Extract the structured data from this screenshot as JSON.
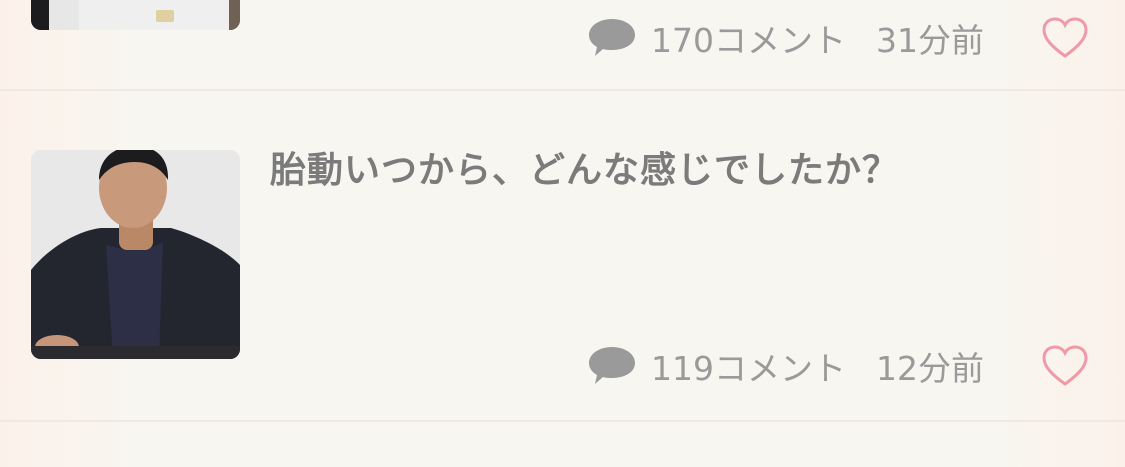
{
  "feed": {
    "items": [
      {
        "comments": "170コメント",
        "time": "31分前",
        "icons": {
          "comment": "speech-bubble-icon",
          "like": "heart-outline-icon"
        }
      },
      {
        "title": "胎動いつから、どんな感じでしたか？",
        "comments": "119コメント",
        "time": "12分前",
        "icons": {
          "comment": "speech-bubble-icon",
          "like": "heart-outline-icon"
        }
      }
    ]
  },
  "colors": {
    "text": "#7b7b7b",
    "meta": "#9a9a9a",
    "heart": "#ee9aa8",
    "background": "#f8f6f0"
  }
}
